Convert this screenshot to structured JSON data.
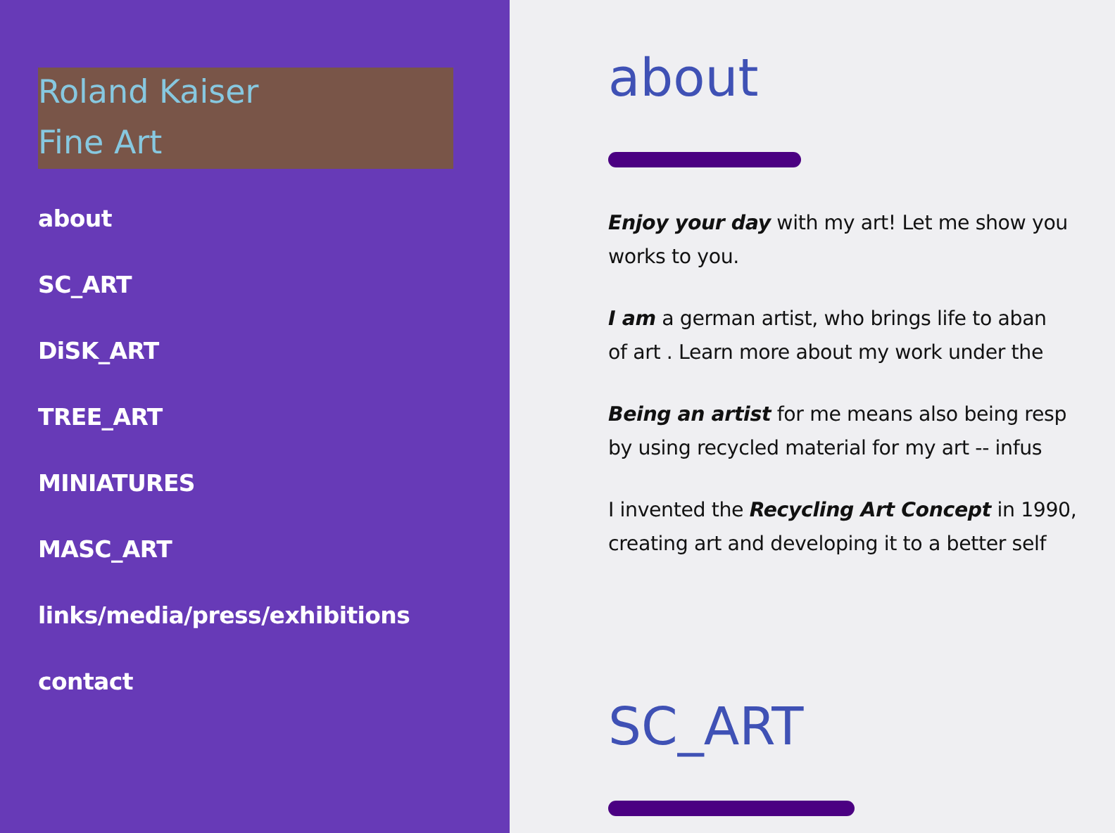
{
  "sidebar": {
    "title_lines": [
      "Roland Kaiser",
      "Fine Art"
    ],
    "nav": [
      "about",
      "SC_ART",
      "DiSK_ART",
      "TREE_ART",
      "MINIATURES",
      "MASC_ART",
      "links/media/press/exhibitions",
      "contact"
    ]
  },
  "sections": [
    {
      "heading": "about",
      "paragraphs": [
        [
          "**Enjoy your day** with my art! Let me show you",
          "works to you."
        ],
        [
          "**I am** a german artist, who brings life to aban",
          "of art . Learn more about my work under the"
        ],
        [
          "**Being an artist** for me means also being resp",
          "by using recycled material for my art -- infus"
        ],
        [
          "I invented the **Recycling Art Concept** in 1990,",
          "creating art and developing it to a better self"
        ]
      ]
    },
    {
      "heading": "SC_ART"
    }
  ]
}
